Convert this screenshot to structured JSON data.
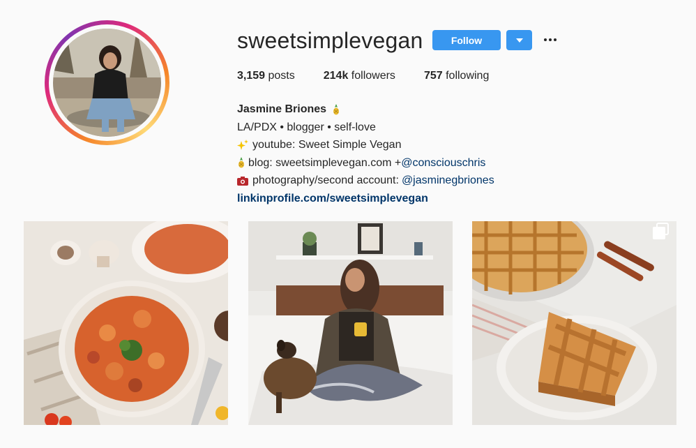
{
  "profile": {
    "username": "sweetsimplevegan",
    "follow_label": "Follow",
    "stats": {
      "posts_count": "3,159",
      "posts_label": "posts",
      "followers_count": "214k",
      "followers_label": "followers",
      "following_count": "757",
      "following_label": "following"
    },
    "bio": {
      "name": "Jasmine Briones",
      "line1": "LA/PDX • blogger • self-love",
      "line2": "youtube: Sweet Simple Vegan",
      "line3_prefix": "blog: sweetsimplevegan.com +",
      "line3_mention": "@consciouschris",
      "line4_prefix": "photography/second account: ",
      "line4_mention": "@jasminegbriones",
      "link": "linkinprofile.com/sweetsimplevegan"
    }
  },
  "icons": {
    "name_emoji": "pineapple-icon",
    "line2_emoji": "sparkles-icon",
    "line3_emoji": "pineapple-icon",
    "line4_emoji": "camera-icon",
    "dropdown": "caret-down-icon",
    "more": "more-dots-icon",
    "carousel": "multiple-images-icon"
  },
  "posts": [
    {
      "subject": "pasta-dish"
    },
    {
      "subject": "woman-with-dog-on-bed"
    },
    {
      "subject": "pie-slice",
      "multiple": true
    }
  ],
  "colors": {
    "accent": "#3897f0",
    "link": "#003569",
    "text": "#262626",
    "background": "#fafafa"
  }
}
